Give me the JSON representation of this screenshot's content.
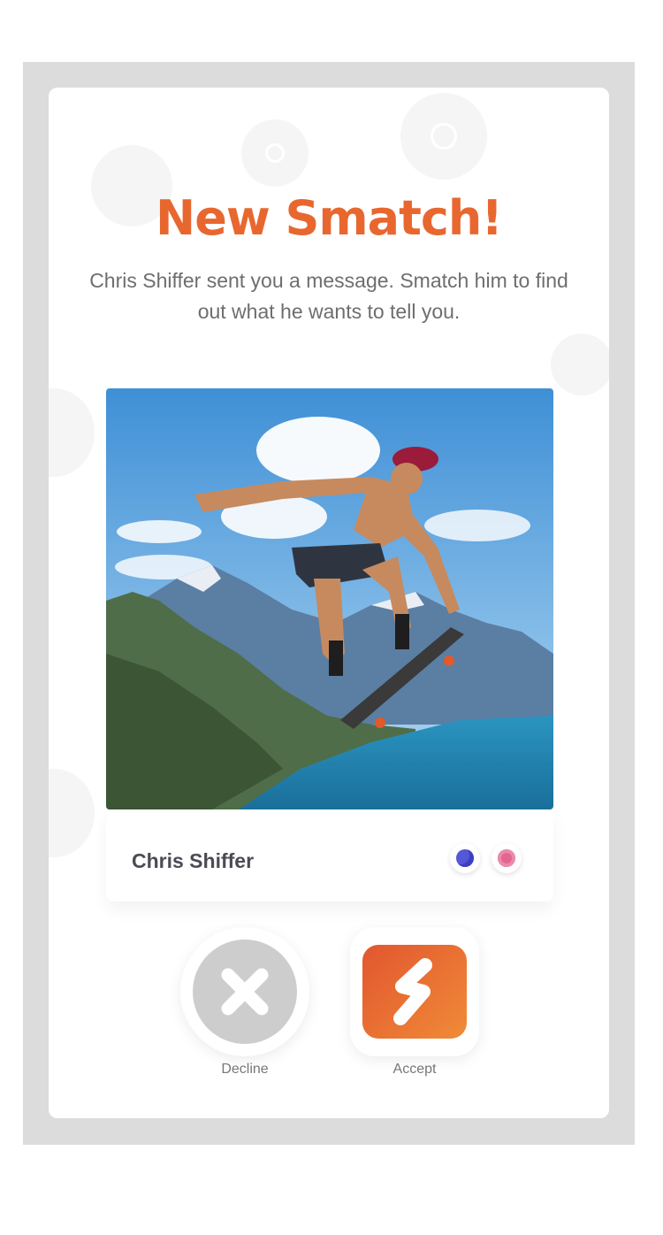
{
  "modal": {
    "title": "New Smatch!",
    "message": "Chris Shiffer sent you a message. Smatch him to find out what he wants to tell you."
  },
  "profile": {
    "name": "Chris Shiffer",
    "photo_icon": "skateboarder-photo",
    "badges": [
      {
        "icon": "blue-circle-icon",
        "color": "#5457d8"
      },
      {
        "icon": "pink-circle-icon",
        "color": "#e2668f"
      }
    ]
  },
  "actions": {
    "decline_label": "Decline",
    "accept_label": "Accept",
    "decline_icon": "close-icon",
    "accept_icon": "smatch-logo-icon"
  },
  "colors": {
    "accent": "#e8672f",
    "frame": "#dcdcdc",
    "decline": "#cdcdcd"
  }
}
